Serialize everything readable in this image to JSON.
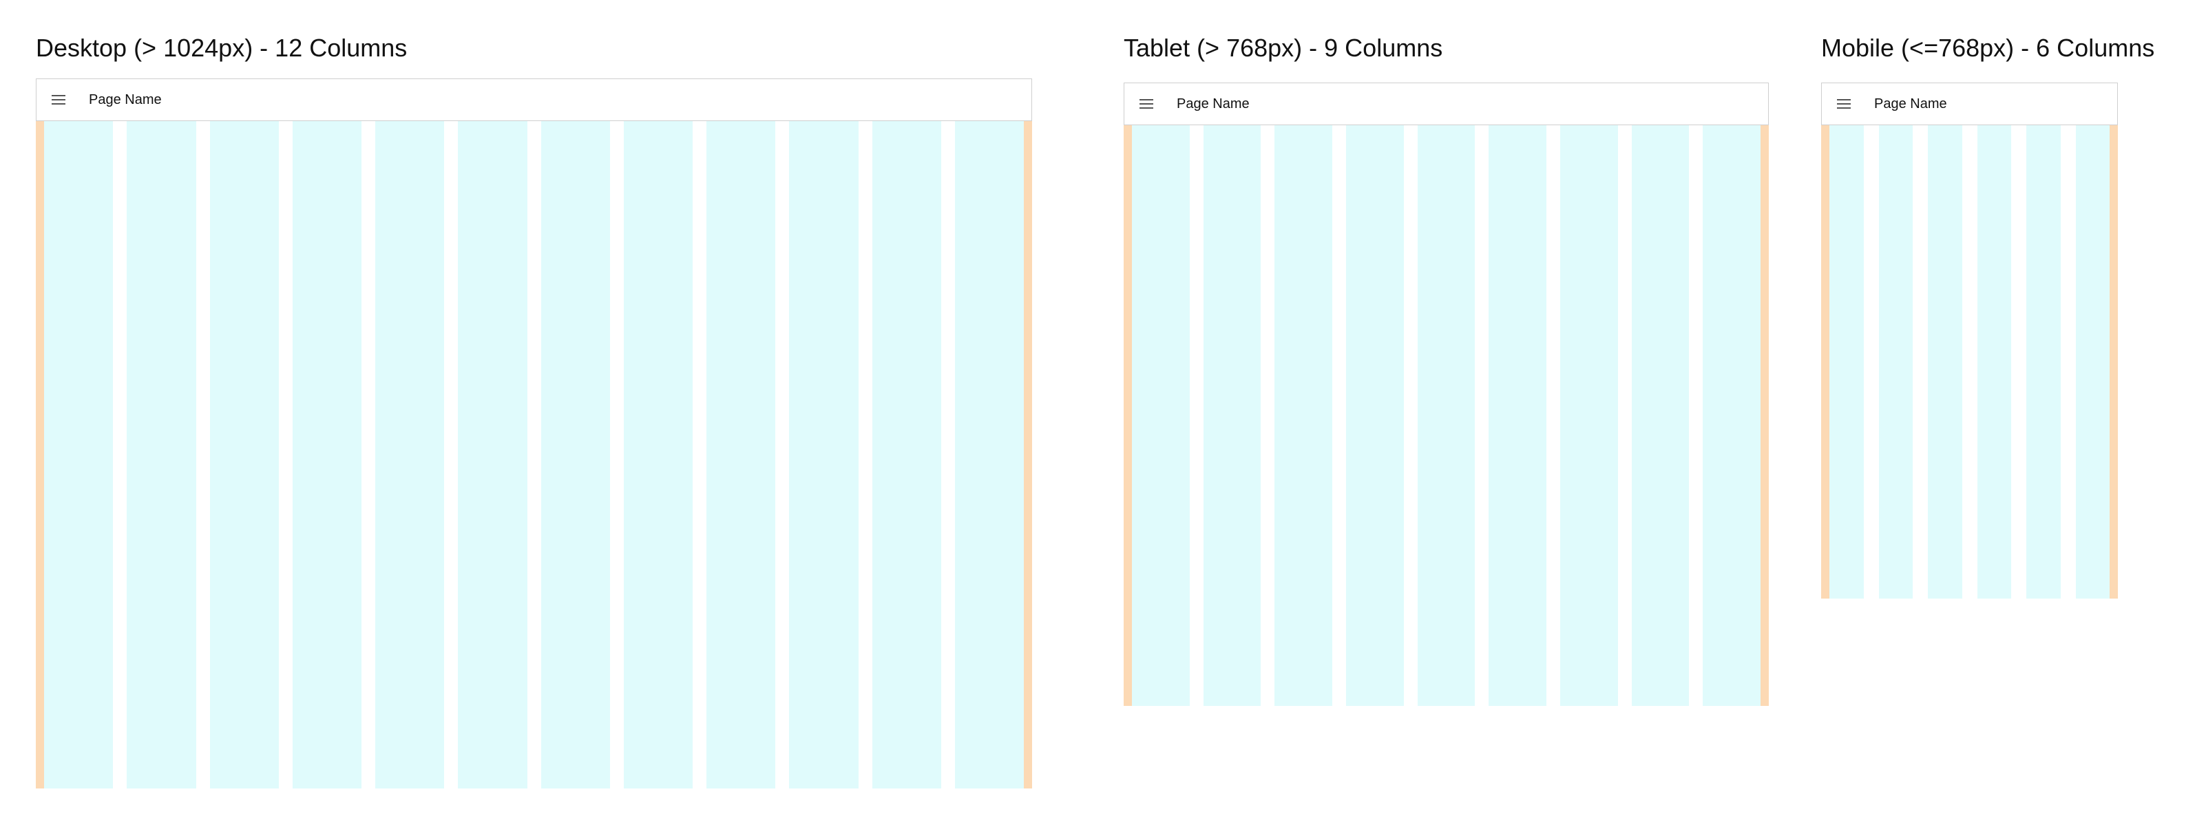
{
  "colors": {
    "margin": "#fcd9b4",
    "column": "#e0fbfc",
    "appbar_border": "#cfcfcf",
    "background": "#ffffff"
  },
  "icons": {
    "menu": "hamburger-menu-icon"
  },
  "panels": {
    "desktop": {
      "title": "Desktop (> 1024px) - 12 Columns",
      "page_name": "Page Name",
      "columns": 12
    },
    "tablet": {
      "title": "Tablet (> 768px) - 9 Columns",
      "page_name": "Page Name",
      "columns": 9
    },
    "mobile": {
      "title": "Mobile (<=768px) - 6 Columns",
      "page_name": "Page Name",
      "columns": 6
    }
  }
}
